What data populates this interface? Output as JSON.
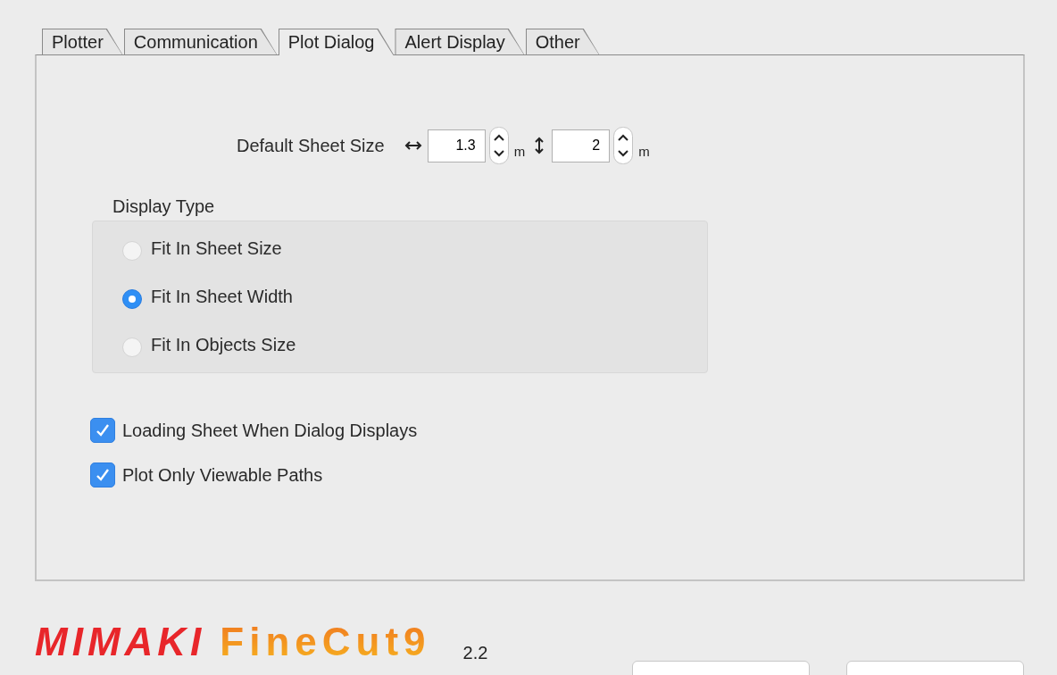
{
  "tabs": [
    {
      "label": "Plotter",
      "selected": false
    },
    {
      "label": "Communication",
      "selected": false
    },
    {
      "label": "Plot Dialog",
      "selected": true
    },
    {
      "label": "Alert Display",
      "selected": false
    },
    {
      "label": "Other",
      "selected": false
    }
  ],
  "sheet_size": {
    "label": "Default Sheet Size",
    "width": {
      "value": "1.3",
      "unit": "m"
    },
    "height": {
      "value": "2",
      "unit": "m"
    }
  },
  "display_type": {
    "label": "Display Type",
    "options": [
      {
        "label": "Fit In Sheet Size",
        "selected": false
      },
      {
        "label": "Fit In Sheet Width",
        "selected": true
      },
      {
        "label": "Fit In Objects Size",
        "selected": false
      }
    ]
  },
  "checkboxes": [
    {
      "label": "Loading Sheet When Dialog Displays",
      "checked": true
    },
    {
      "label": "Plot Only Viewable Paths",
      "checked": true
    }
  ],
  "logo": {
    "brand": "MIMAKI",
    "product": "FineCut9"
  },
  "version": "2.2"
}
